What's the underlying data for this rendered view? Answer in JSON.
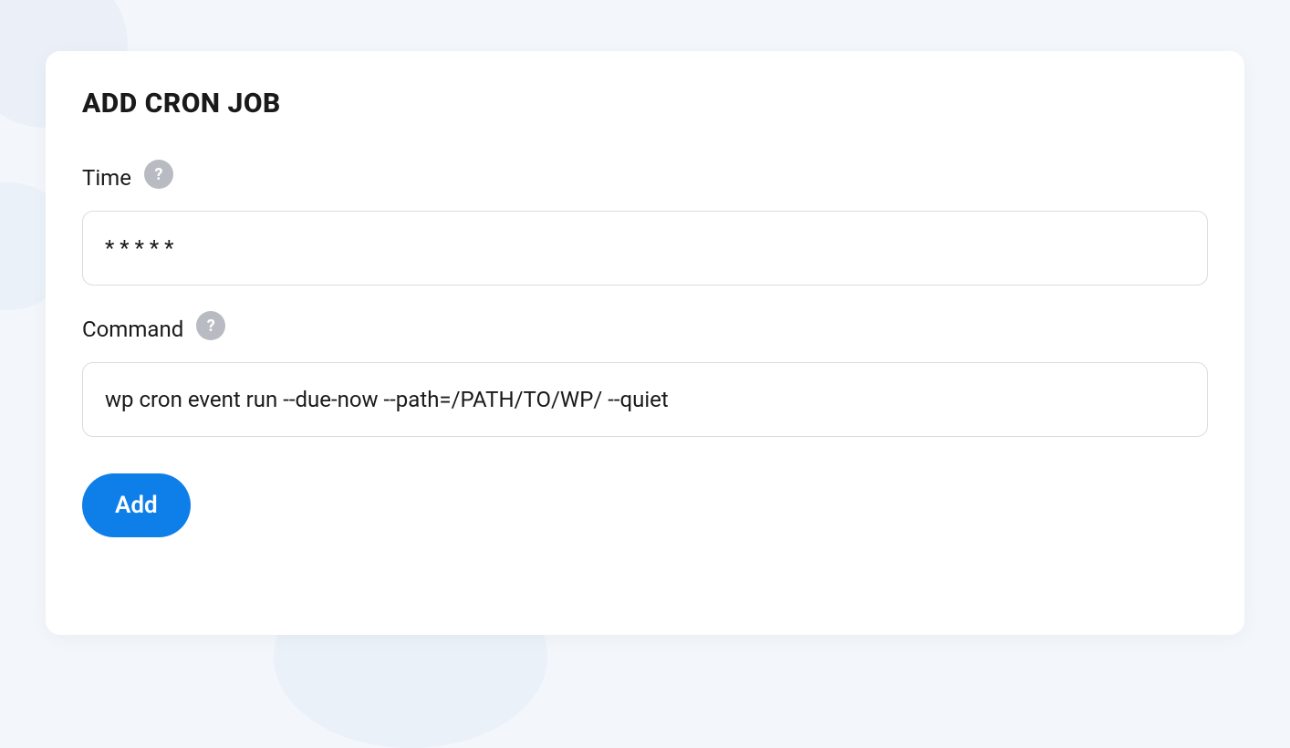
{
  "card": {
    "title": "ADD CRON JOB"
  },
  "fields": {
    "time": {
      "label": "Time",
      "value": "* * * * *",
      "help_icon_label": "?"
    },
    "command": {
      "label": "Command",
      "value": "wp cron event run --due-now --path=/PATH/TO/WP/ --quiet",
      "help_icon_label": "?"
    }
  },
  "buttons": {
    "submit": "Add"
  }
}
